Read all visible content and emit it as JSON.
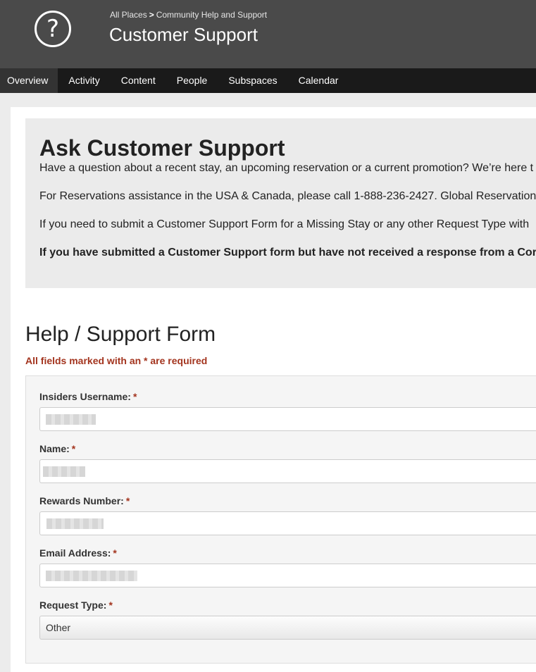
{
  "header": {
    "icon": "question-circle-icon",
    "breadcrumb": {
      "root": "All Places",
      "separator": ">",
      "current": "Community Help and Support"
    },
    "title": "Customer Support"
  },
  "nav": {
    "tabs": [
      {
        "label": "Overview",
        "active": true
      },
      {
        "label": "Activity"
      },
      {
        "label": "Content"
      },
      {
        "label": "People"
      },
      {
        "label": "Subspaces"
      },
      {
        "label": "Calendar"
      }
    ]
  },
  "ask": {
    "title": "Ask Customer Support",
    "p1": "Have a question about a recent stay, an upcoming reservation or a current promotion? We’re here t",
    "p2": "For Reservations assistance in the USA & Canada, please call 1-888-236-2427. Global Reservation",
    "p3": "If you need to submit a Customer Support Form for a Missing Stay or any other Request Type with",
    "p4": "If you have submitted a Customer Support form but have not received a response from a Cor"
  },
  "form": {
    "title": "Help / Support Form",
    "required_note": "All fields marked with an * are required",
    "required_mark": "*",
    "fields": [
      {
        "label": "Insiders Username:"
      },
      {
        "label": "Name:"
      },
      {
        "label": "Rewards Number:"
      },
      {
        "label": "Email Address:"
      },
      {
        "label": "Request Type:",
        "value": "Other"
      }
    ]
  },
  "colors": {
    "header_bg": "#4a4a4a",
    "nav_bg": "#1a1a1a",
    "required": "#a3341e"
  }
}
